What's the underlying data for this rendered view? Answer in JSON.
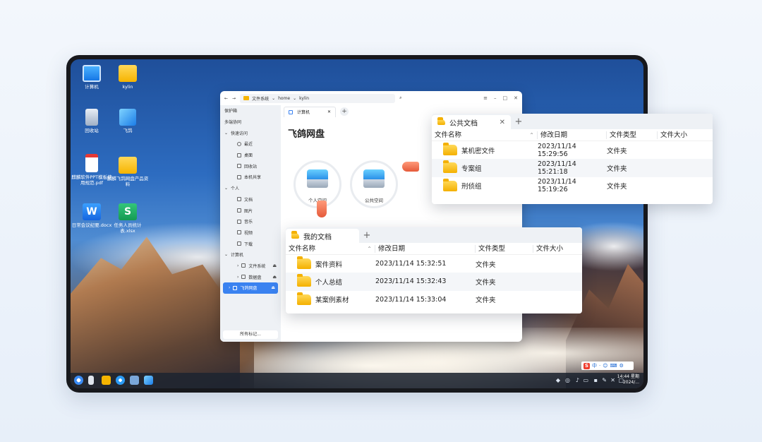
{
  "desktop": {
    "icons": [
      {
        "label": "计算机"
      },
      {
        "label": "kylin"
      },
      {
        "label": "回收站"
      },
      {
        "label": "飞鸽"
      },
      {
        "label": "麒麟软件PPT模板使用规范.pdf"
      },
      {
        "label": "麒麟飞鸽网盘产品资料"
      },
      {
        "label": "日常会议纪要.docx"
      },
      {
        "label": "任务人员统计表.xlsx"
      }
    ]
  },
  "file_manager": {
    "address": {
      "root": "文件系统",
      "seg1": "home",
      "seg2": "kylin"
    },
    "sidebar": {
      "items": [
        {
          "label": "保护箱"
        },
        {
          "label": "多端协同"
        },
        {
          "label": "快速访问"
        },
        {
          "label": "最近"
        },
        {
          "label": "桌面"
        },
        {
          "label": "回收站"
        },
        {
          "label": "本机共享"
        },
        {
          "label": "个人"
        },
        {
          "label": "文档"
        },
        {
          "label": "图片"
        },
        {
          "label": "音乐"
        },
        {
          "label": "视频"
        },
        {
          "label": "下载"
        },
        {
          "label": "计算机"
        },
        {
          "label": "文件系统"
        },
        {
          "label": "数据盘"
        },
        {
          "label": "飞鸽网盘"
        }
      ],
      "footer": "所有标记..."
    },
    "tab": {
      "label": "计算机"
    },
    "title": "飞鸽网盘",
    "disks": [
      {
        "label": "个人空间"
      },
      {
        "label": "公共空间"
      }
    ]
  },
  "public_panel": {
    "tab": "公共文档",
    "columns": [
      "文件名称",
      "修改日期",
      "文件类型",
      "文件大小"
    ],
    "rows": [
      {
        "name": "某机密文件",
        "date": "2023/11/14 15:29:56",
        "type": "文件夹",
        "size": ""
      },
      {
        "name": "专案组",
        "date": "2023/11/14 15:21:18",
        "type": "文件夹",
        "size": ""
      },
      {
        "name": "刑侦组",
        "date": "2023/11/14 15:19:26",
        "type": "文件夹",
        "size": ""
      }
    ]
  },
  "my_panel": {
    "tab": "我的文档",
    "columns": [
      "文件名称",
      "修改日期",
      "文件类型",
      "文件大小"
    ],
    "rows": [
      {
        "name": "案件资料",
        "date": "2023/11/14 15:32:51",
        "type": "文件夹",
        "size": ""
      },
      {
        "name": "个人总结",
        "date": "2023/11/14 15:32:43",
        "type": "文件夹",
        "size": ""
      },
      {
        "name": "某案例素材",
        "date": "2023/11/14 15:33:04",
        "type": "文件夹",
        "size": ""
      }
    ]
  },
  "taskbar": {
    "ime": {
      "logo": "S",
      "mode": "中"
    },
    "clock": {
      "time": "14:44 星期",
      "date": "2024/..."
    }
  }
}
